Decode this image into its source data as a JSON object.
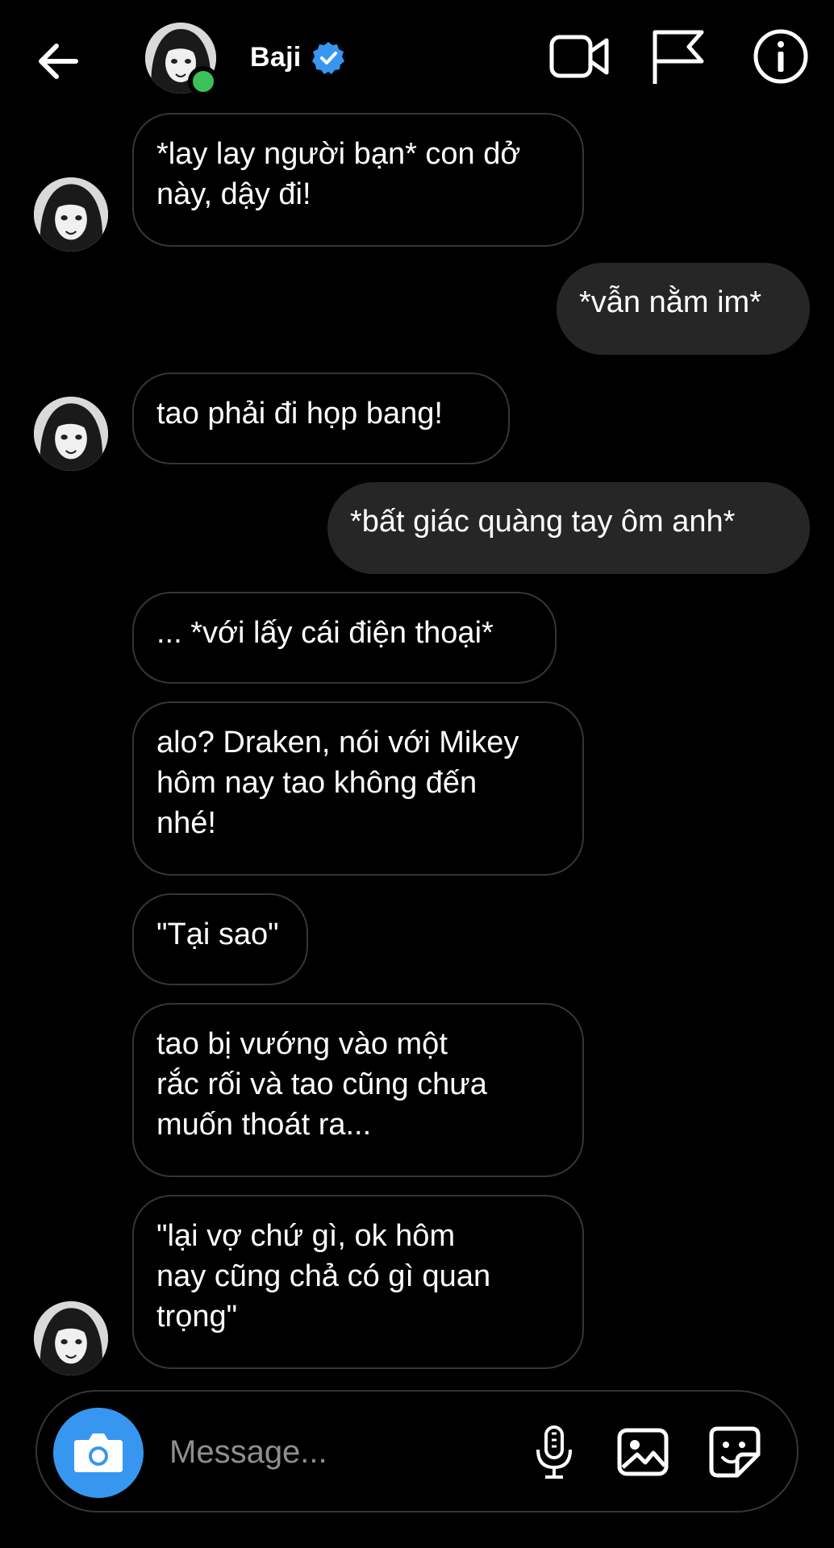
{
  "header": {
    "name": "Baji",
    "icons": [
      "back-arrow-icon",
      "avatar",
      "verified-badge-icon",
      "video-call-icon",
      "flag-icon",
      "info-icon"
    ],
    "online_color": "#3cc05a",
    "verified_color": "#3797f0"
  },
  "messages": [
    {
      "side": "in",
      "text": "*lay lay người bạn* con dở\nnày, dậy đi!"
    },
    {
      "side": "out",
      "text": "*vẫn nằm im*"
    },
    {
      "side": "in",
      "text": "tao phải đi họp bang!"
    },
    {
      "side": "out",
      "text": "*bất giác quàng tay ôm anh*"
    },
    {
      "side": "in",
      "text": "... *với lấy cái điện thoại*"
    },
    {
      "side": "in",
      "text": "alo? Draken, nói với Mikey\nhôm nay tao không đến\nnhé!"
    },
    {
      "side": "in",
      "text": "\"Tại sao\""
    },
    {
      "side": "in",
      "text": "tao bị vướng vào một\nrắc rối và tao cũng chưa\nmuốn thoát ra..."
    },
    {
      "side": "in",
      "text": "\"lại vợ chứ gì, ok hôm\nnay cũng chả có gì quan\ntrọng\""
    }
  ],
  "composer": {
    "placeholder": "Message...",
    "icons": [
      "camera-icon",
      "microphone-icon",
      "gallery-icon",
      "sticker-icon"
    ],
    "camera_color": "#3797f0"
  },
  "colors": {
    "background": "#000000",
    "incoming_border": "#363636",
    "outgoing_fill": "#262626"
  }
}
